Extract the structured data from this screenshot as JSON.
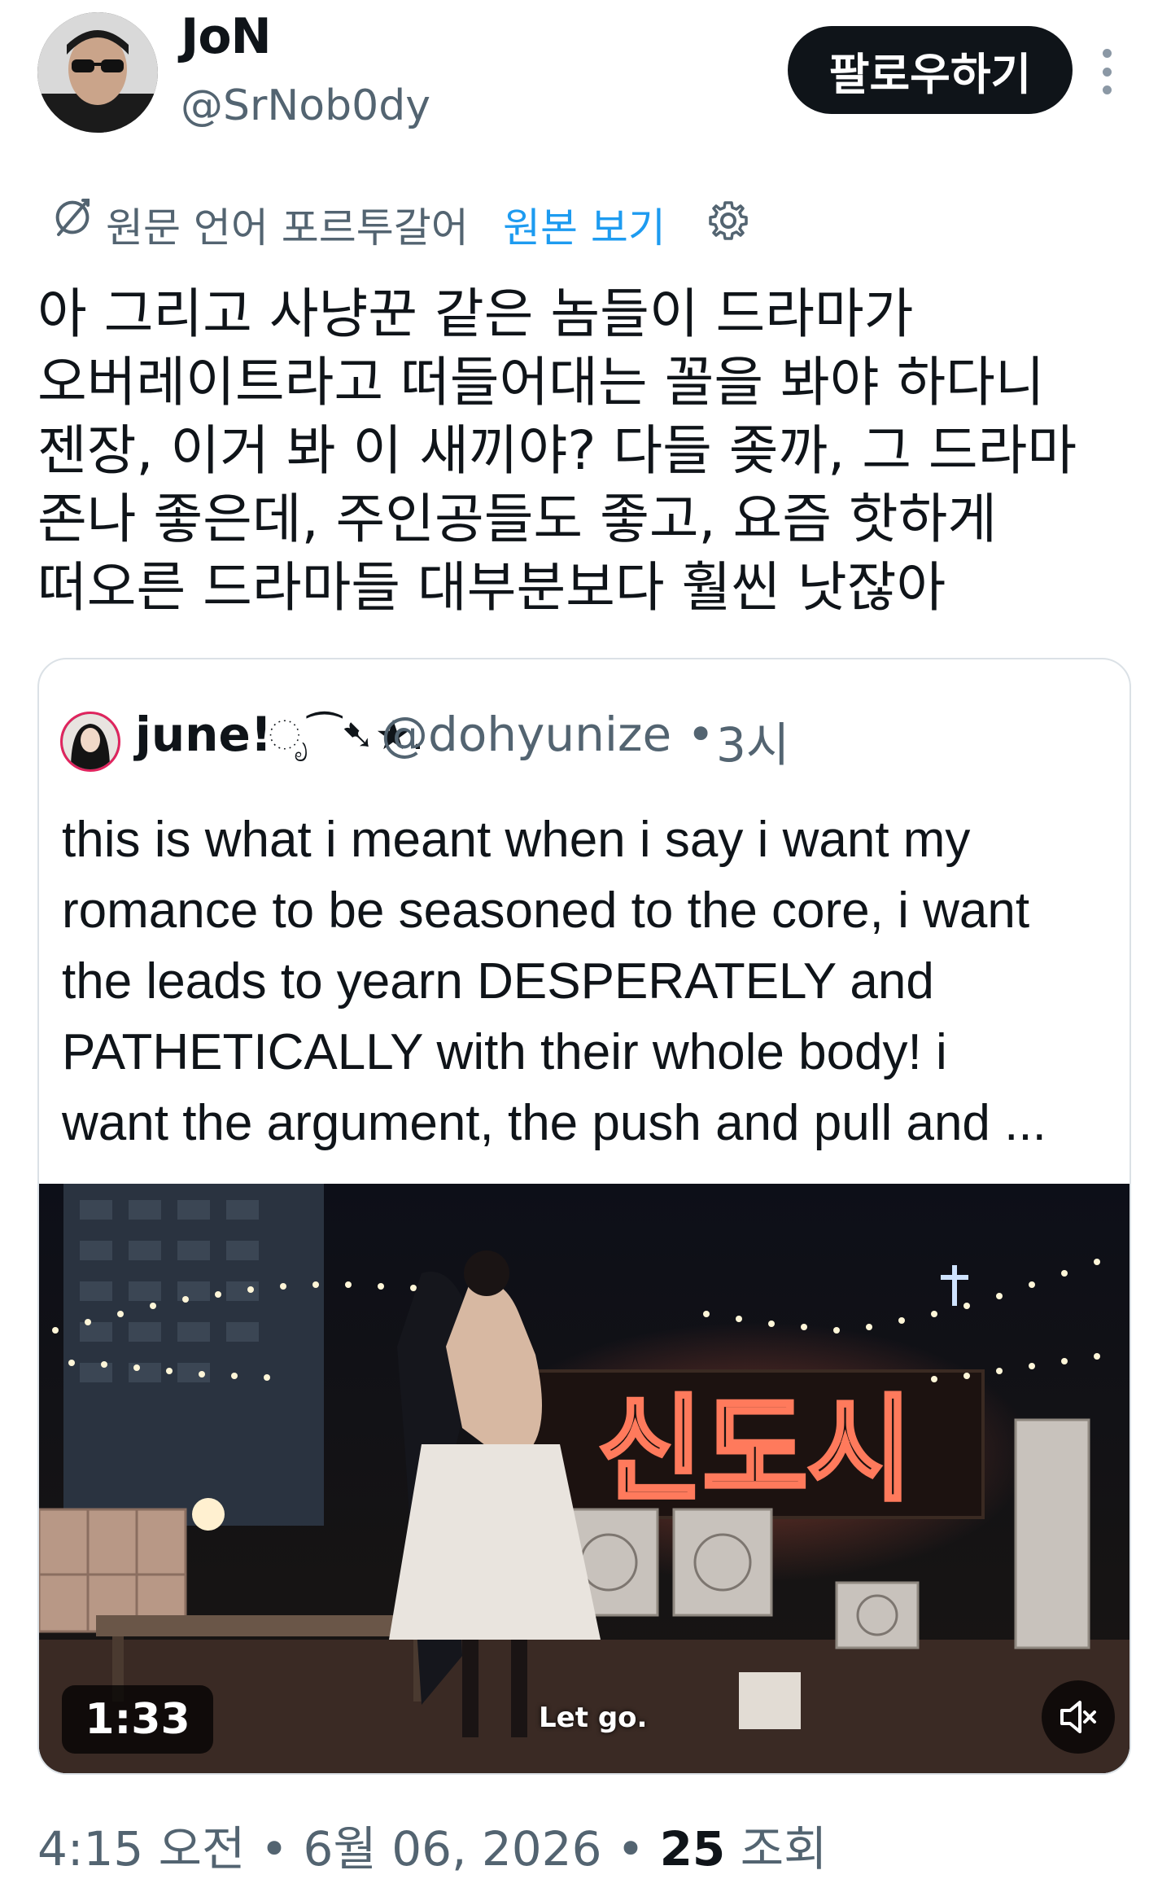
{
  "author": {
    "name": "JoN",
    "handle": "@SrNob0dy",
    "follow_label": "팔로우하기"
  },
  "translation": {
    "notice": "원문 언어 포르투갈어",
    "show_original": "원본 보기"
  },
  "tweet": {
    "lines": [
      "아 그리고 사냥꾼 같은 놈들이 드라마가",
      "오버레이트라고 떠들어대는 꼴을 봐야 하다니",
      "젠장, 이거 봐 이 새끼야? 다들 좆까, 그 드라마",
      "존나 좋은데, 주인공들도 좋고, 요즘 핫하게",
      "떠오른 드라마들 대부분보다 훨씬 낫잖아"
    ]
  },
  "quote": {
    "name": "june!",
    "name_deco": "ೃ⁀➷★.",
    "handle": "@dohyunize",
    "separator": "•",
    "time": "3시",
    "lines": [
      "this is what i meant when i say i want my",
      "romance to be seasoned to the core, i want",
      "the leads to yearn DESPERATELY and",
      "PATHETICALLY with their whole body! i",
      "want the argument, the push and pull and ..."
    ],
    "video": {
      "duration": "1:33",
      "subtitle": "Let go.",
      "sign_text": "신도시"
    }
  },
  "footer": {
    "time": "4:15 오전",
    "date": "6월 06, 2026",
    "views_count": "25",
    "views_label": "조회",
    "separator": "•"
  },
  "colors": {
    "link": "#1d9bf0",
    "secondary_text": "#536471",
    "primary_text": "#0f1419",
    "button_bg": "#0f1419"
  }
}
